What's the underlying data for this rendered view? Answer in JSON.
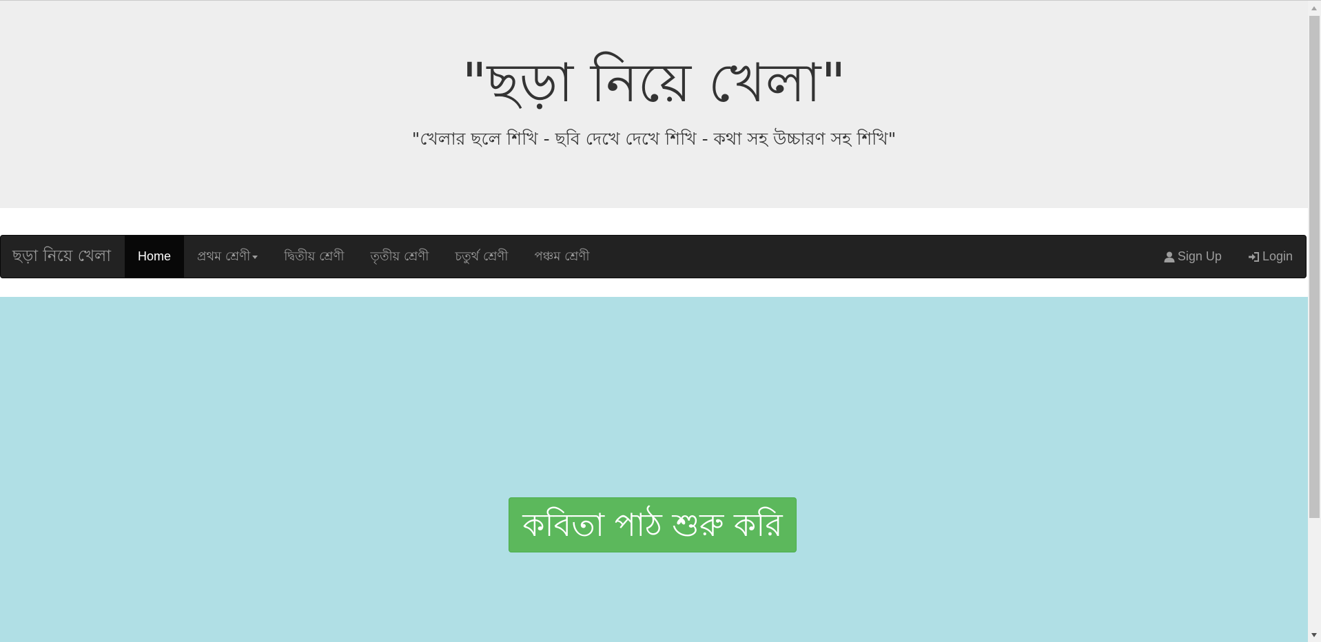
{
  "header": {
    "title": "\"ছড়া নিয়ে খেলা\"",
    "tagline": "\"খেলার ছলে শিখি - ছবি দেখে দেখে শিখি - কথা সহ উচ্চারণ সহ শিখি\""
  },
  "navbar": {
    "brand": "ছড়া নিয়ে খেলা",
    "items": [
      {
        "label": "Home",
        "active": true
      },
      {
        "label": "প্রথম শ্রেণী",
        "dropdown": true
      },
      {
        "label": "দ্বিতীয় শ্রেণী"
      },
      {
        "label": "তৃতীয় শ্রেণী"
      },
      {
        "label": "চতুর্থ শ্রেণী"
      },
      {
        "label": "পঞ্চম শ্রেণী"
      }
    ],
    "right": [
      {
        "label": "Sign Up",
        "icon": "user-icon"
      },
      {
        "label": "Login",
        "icon": "login-icon"
      }
    ]
  },
  "hero": {
    "button_label": "কবিতা পাঠ শুরু করি"
  },
  "colors": {
    "jumbotron_bg": "#eeeeee",
    "navbar_bg": "#222222",
    "hero_bg": "#b0dfe5",
    "button_bg": "#5cb85c"
  }
}
